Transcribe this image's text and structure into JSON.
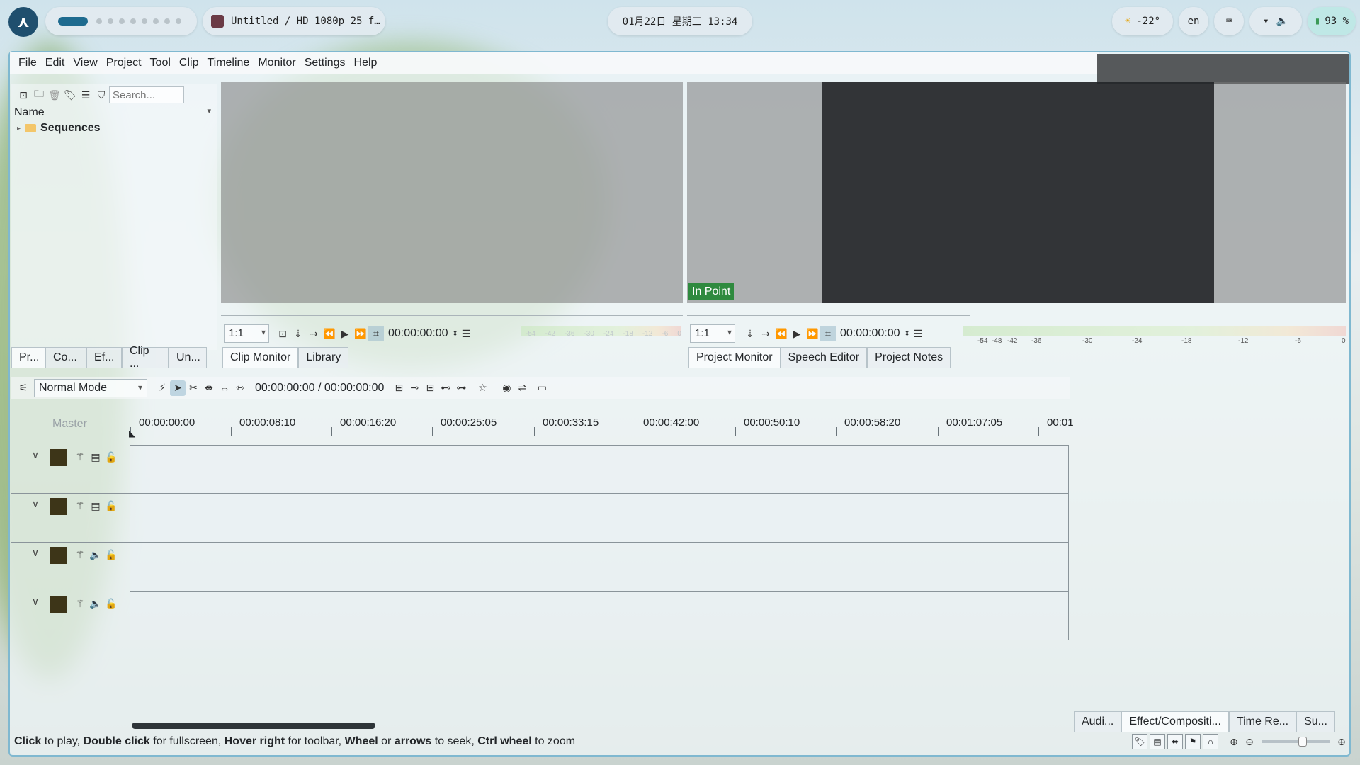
{
  "panel": {
    "window_title": "Untitled / HD 1080p 25 f…",
    "clock": "01月22日  星期三  13:34",
    "weather": "-22°",
    "keyboard_layout": "en",
    "battery": "93 %"
  },
  "menu": {
    "items": [
      "File",
      "Edit",
      "View",
      "Project",
      "Tool",
      "Clip",
      "Timeline",
      "Monitor",
      "Settings",
      "Help"
    ]
  },
  "bin": {
    "search_placeholder": "Search...",
    "column_header": "Name",
    "folder": "Sequences",
    "tabs": [
      "Pr...",
      "Co...",
      "Ef...",
      "Clip ...",
      "Un..."
    ]
  },
  "clip_monitor": {
    "zoom": "1:1",
    "timecode": "00:00:00:00",
    "meter_scale": [
      "-54",
      "-42",
      "-36",
      "-30",
      "-24",
      "-18",
      "-12",
      "-6",
      "0"
    ],
    "tabs": [
      "Clip Monitor",
      "Library"
    ]
  },
  "project_monitor": {
    "overlay": "In Point",
    "zoom": "1:1",
    "timecode": "00:00:00:00",
    "meter_scale": [
      "-54",
      "-48",
      "-42",
      "-36",
      "-30",
      "-24",
      "-18",
      "-12",
      "-6",
      "0"
    ],
    "tabs": [
      "Project Monitor",
      "Speech Editor",
      "Project Notes"
    ]
  },
  "timeline": {
    "mode": "Normal Mode",
    "position": "00:00:00:00 / 00:00:00:00",
    "master_label": "Master",
    "ruler": [
      "00:00:00:00",
      "00:00:08:10",
      "00:00:16:20",
      "00:00:25:05",
      "00:00:33:15",
      "00:00:42:00",
      "00:00:50:10",
      "00:00:58:20",
      "00:01:07:05",
      "00:01"
    ],
    "tracks": [
      {
        "kind": "video",
        "icon": "film-icon"
      },
      {
        "kind": "video",
        "icon": "film-icon"
      },
      {
        "kind": "audio",
        "icon": "speaker-icon"
      },
      {
        "kind": "audio",
        "icon": "speaker-icon"
      }
    ]
  },
  "bottom_tabs": [
    "Audi...",
    "Effect/Compositi...",
    "Time Re...",
    "Su..."
  ],
  "status": {
    "s1": "Click",
    "s2": " to play, ",
    "s3": "Double click",
    "s4": " for fullscreen, ",
    "s5": "Hover right",
    "s6": " for toolbar, ",
    "s7": "Wheel",
    "s8": " or ",
    "s9": "arrows",
    "s10": " to seek, ",
    "s11": "Ctrl wheel",
    "s12": " to zoom"
  },
  "colors": {
    "accent": "#1e6b8f",
    "in_point": "#2f8a3f",
    "track_color": "#3d3518"
  }
}
